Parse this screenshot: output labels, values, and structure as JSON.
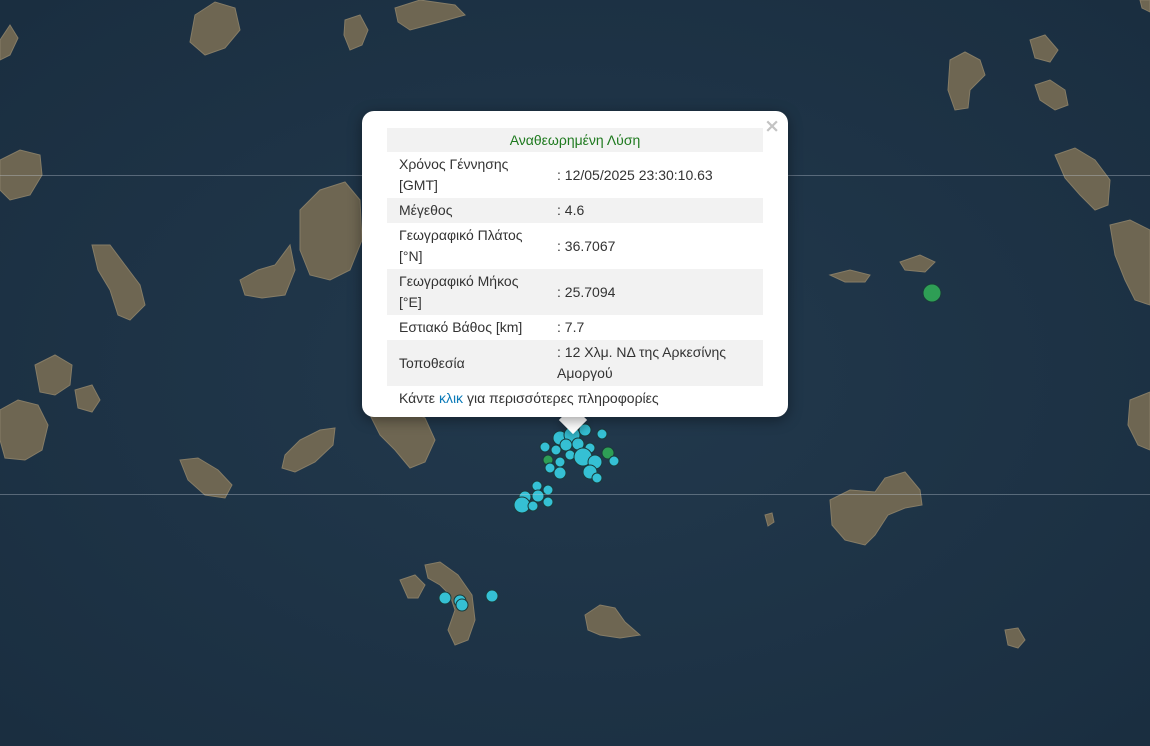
{
  "popup": {
    "header": "Αναθεωρημένη Λύση",
    "close_symbol": "×",
    "rows": [
      {
        "label": "Χρόνος Γέννησης [GMT]",
        "value": ": 12/05/2025 23:30:10.63"
      },
      {
        "label": "Μέγεθος",
        "value": ": 4.6"
      },
      {
        "label": "Γεωγραφικό Πλάτος [°N]",
        "value": ": 36.7067"
      },
      {
        "label": "Γεωγραφικό Μήκος [°E]",
        "value": ": 25.7094"
      },
      {
        "label": "Εστιακό Βάθος [km]",
        "value": ": 7.7"
      },
      {
        "label": "Τοποθεσία",
        "value": ": 12 Χλμ. ΝΔ της Αρκεσίνης Αμοργού"
      }
    ],
    "footer_prefix": "Κάντε",
    "footer_link": "κλικ",
    "footer_suffix": "για περισσότερες πληροφορίες"
  },
  "map": {
    "colors": {
      "sea": "#1e3447",
      "land": "#6b6350",
      "event_recent": "#35c0d4",
      "event_older": "#2e9e55",
      "marker_outline": "#1a3a3a"
    }
  }
}
